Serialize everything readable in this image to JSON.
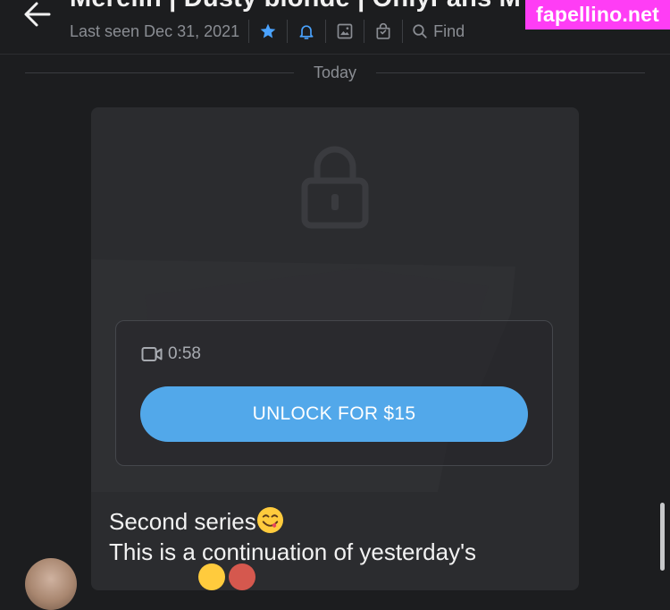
{
  "header": {
    "title": "Merelin | Dusty blonde | OnlyFans M",
    "last_seen": "Last seen Dec 31, 2021",
    "find_label": "Find",
    "icons": [
      "back-arrow-icon",
      "star-icon",
      "bell-icon",
      "image-icon",
      "bag-icon",
      "search-icon"
    ],
    "accent_color": "#4aa3ff"
  },
  "watermark": {
    "text": "fapellino.net",
    "background": "#ff3df5"
  },
  "chat": {
    "date_divider": "Today",
    "message": {
      "locked": true,
      "video_duration": "0:58",
      "unlock_label": "UNLOCK FOR $15",
      "button_color": "#52a8ea",
      "text_line1": "Second series",
      "text_line2": "This is a continuation of yesterday's",
      "emoji": "smiling-face-icon"
    }
  }
}
